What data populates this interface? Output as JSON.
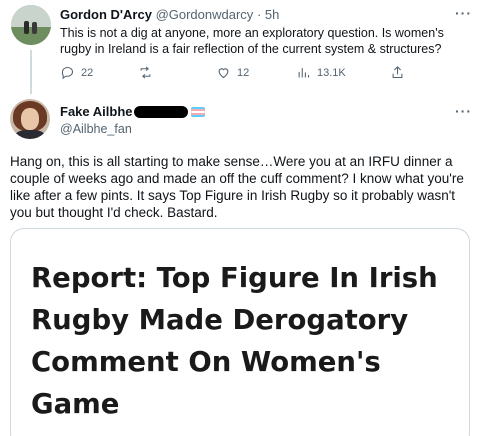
{
  "reply_parent": {
    "display_name": "Gordon D'Arcy",
    "handle": "@Gordonwdarcy",
    "separator": "·",
    "time": "5h",
    "text": "This is not a dig at anyone, more an exploratory question. Is women's rugby in Ireland is a fair reflection of the current system & structures?",
    "stats": {
      "replies": "22",
      "retweets": "",
      "likes": "12",
      "views": "13.1K"
    },
    "more_label": "···"
  },
  "reply": {
    "display_name": "Fake Ailbhe",
    "handle": "@Ailbhe_fan",
    "text": "Hang on, this is all starting to make sense…Were you at an IRFU dinner a couple of weeks ago and made an off the cuff comment? I know what you're like after a few pints. It says Top Figure in Irish Rugby so it probably wasn't you but thought I'd check. Bastard.",
    "more_label": "···",
    "link_card": {
      "headline": "Report: Top Figure In Irish Rugby Made Derogatory Comment On Women's Game"
    }
  },
  "colors": {
    "text": "#0f1419",
    "muted": "#536471",
    "border": "#cfd9de",
    "flag": [
      "#5bcefa",
      "#f5a9b8",
      "#ffffff",
      "#f5a9b8",
      "#5bcefa"
    ]
  },
  "icons": [
    "reply-icon",
    "retweet-icon",
    "like-icon",
    "views-icon",
    "share-icon",
    "more-icon",
    "trans-flag-icon"
  ]
}
